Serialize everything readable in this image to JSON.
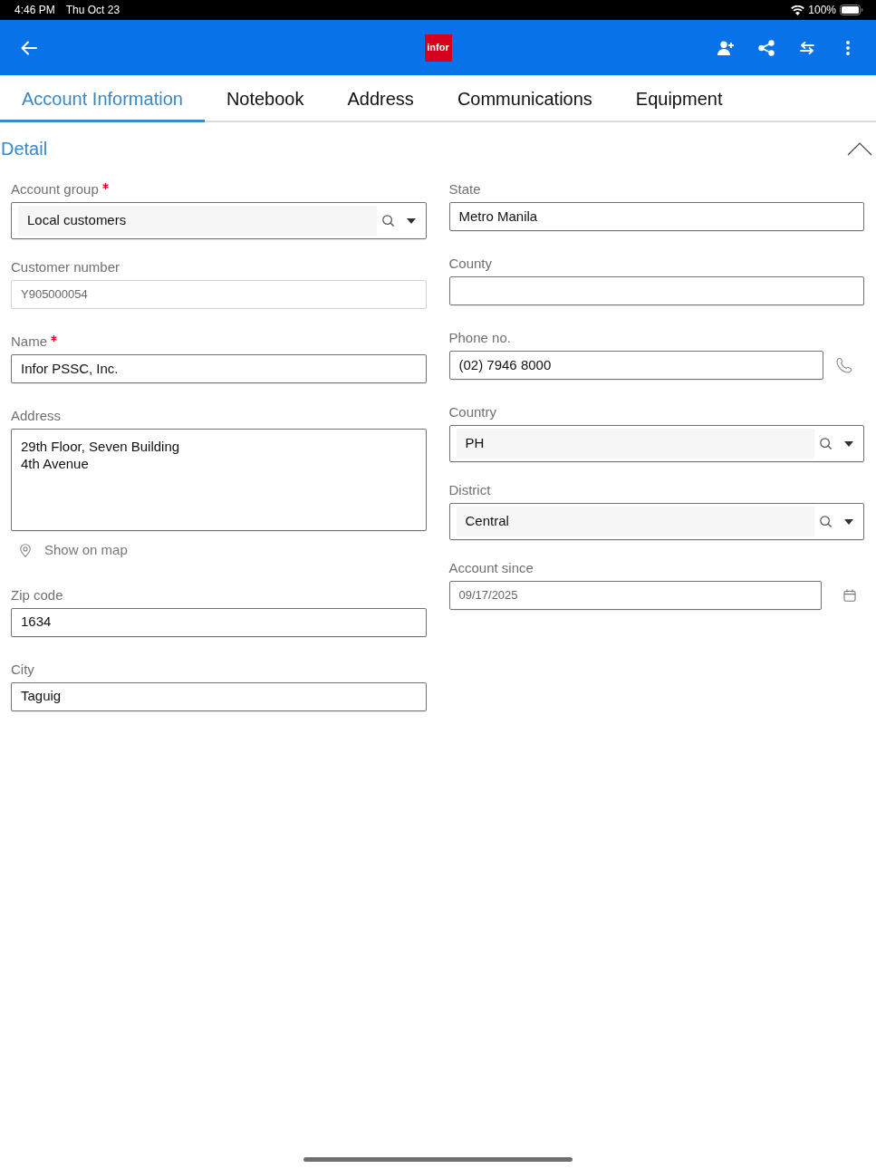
{
  "status_bar": {
    "time": "4:46 PM",
    "date": "Thu Oct 23",
    "battery": "100%"
  },
  "app_bar": {
    "logo": "infor"
  },
  "tabs": [
    {
      "label": "Account Information",
      "selected": true
    },
    {
      "label": "Notebook",
      "selected": false
    },
    {
      "label": "Address",
      "selected": false
    },
    {
      "label": "Communications",
      "selected": false
    },
    {
      "label": "Equipment",
      "selected": false
    }
  ],
  "section": {
    "title": "Detail",
    "expanded": true
  },
  "columns": [
    {
      "fields": [
        {
          "kind": "lookup",
          "label": "Account group",
          "required": true,
          "disabled": false,
          "value": "Local customers"
        },
        {
          "kind": "text",
          "label": "Customer number",
          "required": false,
          "disabled": true,
          "value": "Y905000054"
        },
        {
          "kind": "text",
          "label": "Name",
          "required": true,
          "disabled": false,
          "value": "Infor PSSC, Inc."
        },
        {
          "kind": "textarea",
          "label": "Address",
          "required": false,
          "disabled": false,
          "value": "29th Floor, Seven Building\n4th Avenue",
          "link": "Show on map"
        },
        {
          "kind": "text",
          "label": "Zip code",
          "required": false,
          "disabled": false,
          "value": "1634"
        },
        {
          "kind": "text",
          "label": "City",
          "required": false,
          "disabled": false,
          "value": "Taguig"
        }
      ]
    },
    {
      "fields": [
        {
          "kind": "text",
          "label": "State",
          "required": false,
          "disabled": false,
          "value": "Metro Manila"
        },
        {
          "kind": "text",
          "label": "County",
          "required": false,
          "disabled": false
        },
        {
          "kind": "phone",
          "label": "Phone no.",
          "required": false,
          "disabled": false,
          "value": "(02) 7946 8000"
        },
        {
          "kind": "lookup",
          "label": "Country",
          "required": false,
          "disabled": false,
          "value": "PH"
        },
        {
          "kind": "lookup",
          "label": "District",
          "required": false,
          "disabled": false,
          "value": "Central"
        },
        {
          "kind": "date",
          "label": "Account since",
          "required": false,
          "disabled": false,
          "value": "09/17/2025"
        }
      ]
    }
  ]
}
